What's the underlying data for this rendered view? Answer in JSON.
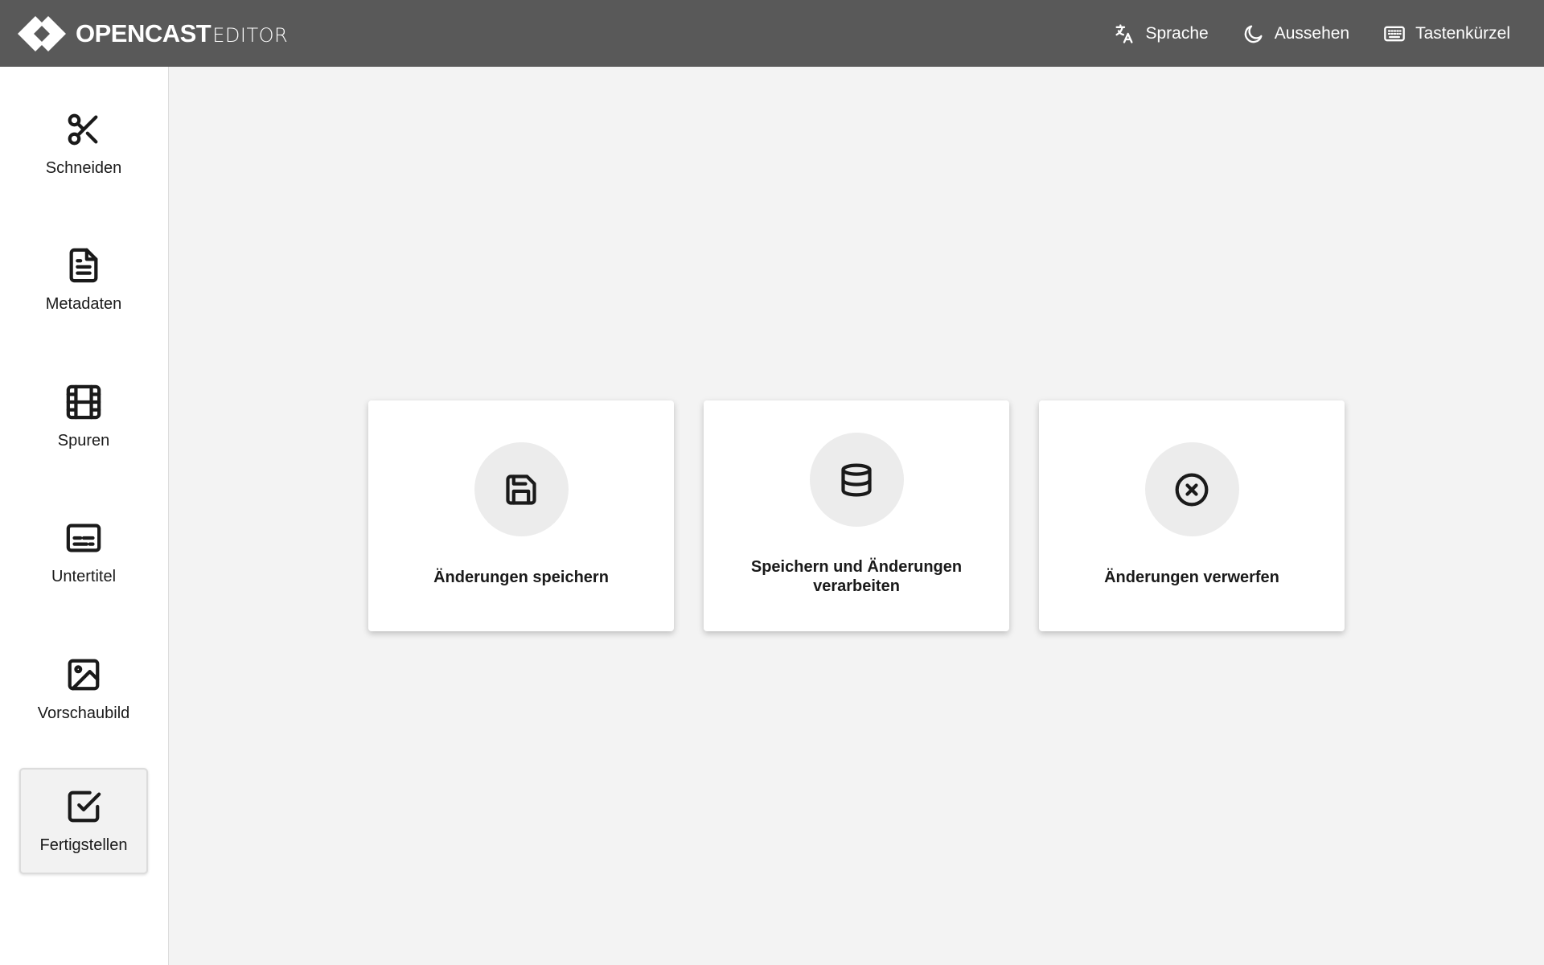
{
  "header": {
    "logo_main": "OPENCAST",
    "logo_sub": "EDITOR",
    "menu": [
      {
        "label": "Sprache",
        "icon": "translate-icon"
      },
      {
        "label": "Aussehen",
        "icon": "moon-icon"
      },
      {
        "label": "Tastenkürzel",
        "icon": "keyboard-icon"
      }
    ]
  },
  "sidebar": {
    "items": [
      {
        "label": "Schneiden",
        "icon": "scissors-icon",
        "active": false
      },
      {
        "label": "Metadaten",
        "icon": "document-icon",
        "active": false
      },
      {
        "label": "Spuren",
        "icon": "film-icon",
        "active": false
      },
      {
        "label": "Untertitel",
        "icon": "subtitles-icon",
        "active": false
      },
      {
        "label": "Vorschaubild",
        "icon": "image-icon",
        "active": false
      },
      {
        "label": "Fertigstellen",
        "icon": "checkbox-icon",
        "active": true
      }
    ]
  },
  "main": {
    "cards": [
      {
        "label": "Änderungen speichern",
        "icon": "save-icon"
      },
      {
        "label": "Speichern und Änderungen verarbeiten",
        "icon": "database-icon"
      },
      {
        "label": "Änderungen verwerfen",
        "icon": "close-circle-icon"
      }
    ]
  },
  "colors": {
    "header_bg": "#595959",
    "sidebar_bg": "#ffffff",
    "main_bg": "#f3f3f3",
    "card_bg": "#ffffff",
    "icon_circle_bg": "#ececec"
  }
}
